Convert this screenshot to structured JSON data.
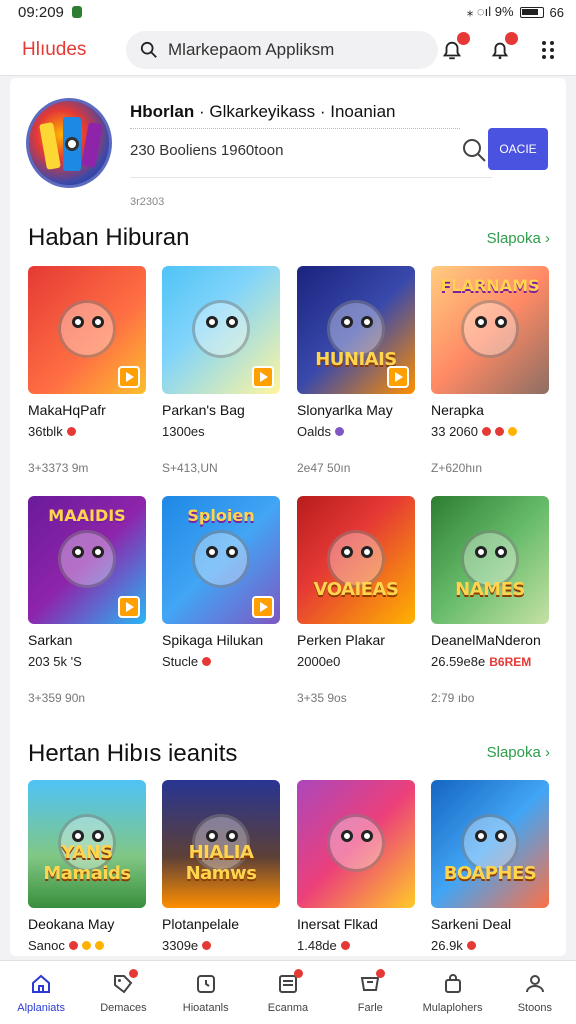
{
  "status_bar": {
    "time": "09:209",
    "right": "⁎ ◌ıl 9%",
    "battery_pct": "66"
  },
  "topbar": {
    "brand": "Hlıudes",
    "search_value": "Mlarkepaom Appliksm",
    "accent": "#e53935"
  },
  "header": {
    "title_bold": "Hborlan",
    "title_rest": " · Glkarkeyikass · Inoanian",
    "subtitle": "230 Booliens 1960toon",
    "meta": "3r2303",
    "button_label": "OACIE",
    "button_color": "#4a52e0"
  },
  "section1": {
    "title": "Haban Hiburan",
    "see_all": "Slapoka ›",
    "tiles": [
      {
        "name": "MakaHqPafr",
        "stat": "36tblk",
        "dots": [
          "#e53935"
        ],
        "meta": "3+3373 9m",
        "art": "",
        "bg": "linear-gradient(135deg,#e53935,#ff7043 60%,#fbc02d)",
        "icon": "play-icon"
      },
      {
        "name": "Parkan's Bag",
        "stat": "1300es",
        "dots": [],
        "meta": "S+413,UN",
        "art": "",
        "bg": "linear-gradient(135deg,#4fc3f7,#81d4fa 40%,#fff59d)",
        "icon": "play-icon"
      },
      {
        "name": "Slonyarlka May",
        "stat": "Oalds",
        "dots": [
          "#7e57c2"
        ],
        "meta": "2e47 50ın",
        "art": "HUNIAIS",
        "bg": "linear-gradient(135deg,#1a237e,#3949ab 50%,#ff8f00)",
        "icon": "play-icon"
      },
      {
        "name": "Nerapka",
        "stat": "33 2060",
        "dots": [
          "#e53935",
          "#e53935",
          "#ffb300"
        ],
        "meta": "Z+620hın",
        "art": "FLARNAMS",
        "bg": "linear-gradient(135deg,#ffcc80,#ff8a65 50%,#8d6e63)",
        "icon": ""
      }
    ]
  },
  "section2": {
    "tiles": [
      {
        "name": "Sarkan",
        "stat": "203 5k 'S",
        "dots": [],
        "meta": "3+359 90n",
        "art": "MAAIDIS",
        "bg": "linear-gradient(135deg,#6a1b9a,#8e24aa 50%,#29b6f6)",
        "icon": "play-icon"
      },
      {
        "name": "Spikaga Hilukan",
        "stat": "Stucle",
        "dots": [
          "#e53935"
        ],
        "meta": "",
        "art": "Sploien",
        "bg": "linear-gradient(135deg,#1e88e5,#42a5f5 50%,#7e57c2)",
        "icon": "play-icon"
      },
      {
        "name": "Perken Plakar",
        "stat": "2000e0",
        "dots": [],
        "meta": "3+35 9os",
        "art": "VOAIEAS",
        "bg": "linear-gradient(135deg,#b71c1c,#e53935 40%,#ffb300)",
        "icon": ""
      },
      {
        "name": "DeanelMaNderon",
        "stat": "26.59e8e",
        "dots": [],
        "stat_badge": "B6REM",
        "meta": "2:79 ıbo",
        "art": "NAMES",
        "bg": "linear-gradient(135deg,#2e7d32,#66bb6a 50%,#c5e1a5)",
        "icon": ""
      }
    ]
  },
  "section3": {
    "title": "Hertan Hibıs ieanits",
    "see_all": "Slapoka ›",
    "tiles": [
      {
        "name": "Deokana May",
        "stat": "Sanoc",
        "dots": [
          "#e53935",
          "#ffb300",
          "#ffb300"
        ],
        "art": "YANS Mamaids",
        "bg": "linear-gradient(180deg,#4fc3f7,#81c784 60%,#388e3c)"
      },
      {
        "name": "Plotanpelale",
        "stat": "3309e",
        "dots": [
          "#e53935"
        ],
        "art": "HIALIA Namws",
        "bg": "linear-gradient(180deg,#283593,#5d4037 60%,#ff8f00)"
      },
      {
        "name": "Inersat Flkad",
        "stat": "1.48de",
        "dots": [
          "#e53935"
        ],
        "art": "",
        "bg": "linear-gradient(135deg,#ab47bc,#ec407a 50%,#ffca28)"
      },
      {
        "name": "Sarkeni Deal",
        "stat": "26.9k",
        "dots": [
          "#e53935"
        ],
        "art": "BOAPHES",
        "bg": "linear-gradient(135deg,#1565c0,#42a5f5 50%,#ff7043)"
      }
    ]
  },
  "bottom_nav": [
    {
      "label": "Alplaniats",
      "icon": "home-icon",
      "active": true,
      "badge": false
    },
    {
      "label": "Demaces",
      "icon": "tag-icon",
      "active": false,
      "badge": true
    },
    {
      "label": "Hioatanls",
      "icon": "clock-icon",
      "active": false,
      "badge": false
    },
    {
      "label": "Ecanma",
      "icon": "list-icon",
      "active": false,
      "badge": true
    },
    {
      "label": "Farle",
      "icon": "cart-icon",
      "active": false,
      "badge": true
    },
    {
      "label": "Mulaplohers",
      "icon": "bag-icon",
      "active": false,
      "badge": false
    },
    {
      "label": "Stoons",
      "icon": "user-icon",
      "active": false,
      "badge": false
    }
  ]
}
